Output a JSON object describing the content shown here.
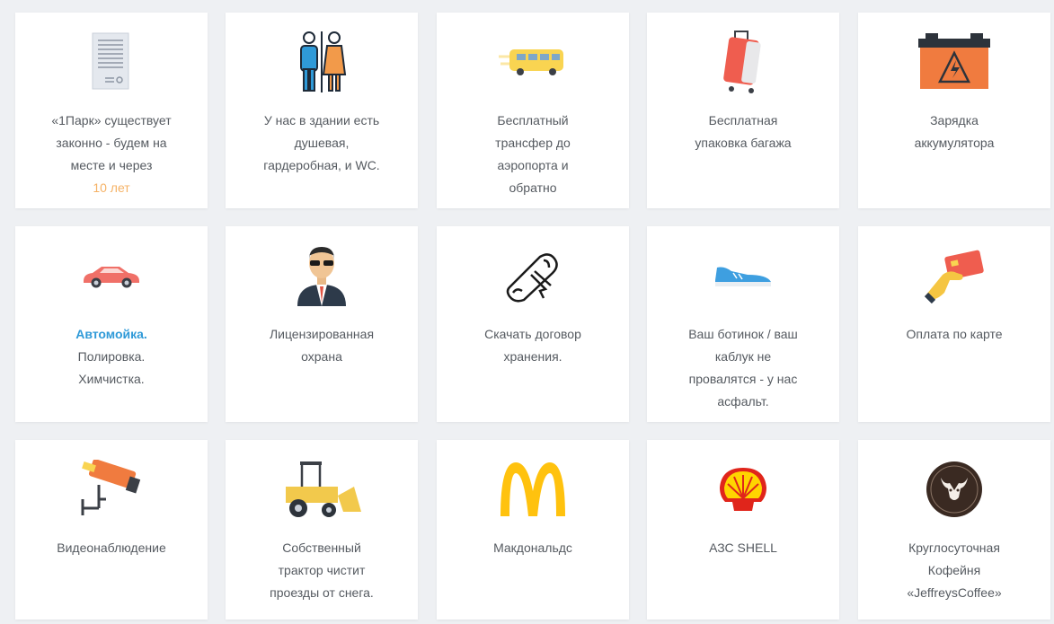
{
  "cards": [
    {
      "lines": [
        "«1Парк» существует",
        "законно - будем на",
        "месте и через"
      ],
      "highlight": "10 лет",
      "icon": "document-icon"
    },
    {
      "lines": [
        "У нас в здании есть",
        "душевая,",
        "гардеробная, и WC."
      ],
      "icon": "restroom-icon"
    },
    {
      "lines": [
        "Бесплатный",
        "трансфер до",
        "аэропорта и",
        "обратно"
      ],
      "icon": "shuttle-bus-icon"
    },
    {
      "lines": [
        "Бесплатная",
        "упаковка багажа"
      ],
      "icon": "luggage-icon"
    },
    {
      "lines": [
        "Зарядка",
        "аккумулятора"
      ],
      "icon": "battery-icon"
    },
    {
      "highlight": "Автомойка.",
      "lines": [
        "Полировка.",
        "Химчистка."
      ],
      "icon": "car-icon"
    },
    {
      "lines": [
        "Лицензированная",
        "охрана"
      ],
      "icon": "security-guard-icon"
    },
    {
      "lines": [
        "Скачать договор",
        "хранения."
      ],
      "icon": "scroll-document-icon"
    },
    {
      "lines": [
        "Ваш ботинок / ваш",
        "каблук не",
        "провалятся - у нас",
        "асфальт."
      ],
      "icon": "sneaker-icon"
    },
    {
      "lines": [
        "Оплата по карте"
      ],
      "icon": "card-payment-icon"
    },
    {
      "lines": [
        "Видеонаблюдение"
      ],
      "icon": "cctv-camera-icon"
    },
    {
      "lines": [
        "Собственный",
        "трактор чистит",
        "проезды от снега."
      ],
      "icon": "tractor-icon"
    },
    {
      "lines": [
        "Макдональдс"
      ],
      "icon": "mcdonalds-logo-icon"
    },
    {
      "lines": [
        "АЗС SHELL"
      ],
      "icon": "shell-logo-icon"
    },
    {
      "lines": [
        "Круглосуточная",
        "Кофейня",
        "«JeffreysCoffee»"
      ],
      "icon": "jeffreys-coffee-logo-icon"
    }
  ],
  "colors": {
    "accent_orange": "#f5b266",
    "accent_blue": "#2f9ad8",
    "text": "#555a60"
  }
}
